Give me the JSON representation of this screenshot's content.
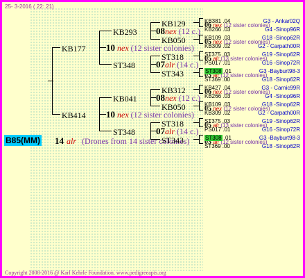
{
  "date": "25-  3-2016 ( 22: 21)",
  "copyright": "Copyright 2008-2016 @ Karl Kehrle Foundation.   www.pedigreeapis.org",
  "root": {
    "id": "B85(MM)",
    "count": "14",
    "race": "alr",
    "note": "(Drones from 14 sister colonies)"
  },
  "level1": [
    {
      "id": "KB177",
      "count": "10",
      "race": "nex",
      "note": "(12 sister colonies)"
    },
    {
      "id": "KB414",
      "count": "10",
      "race": "nex",
      "note": "(12 sister colonies)"
    }
  ],
  "level2": [
    {
      "id": "KB293",
      "count": "08",
      "race": "nex",
      "note": "(12 c.)"
    },
    {
      "id": "ST348",
      "count": "07",
      "race": "alr",
      "note": "(14 c.)"
    },
    {
      "id": "KB041",
      "count": "08",
      "race": "nex",
      "note": "(12 c.)"
    },
    {
      "id": "ST348",
      "count": "07",
      "race": "alr",
      "note": "(14 c.)"
    }
  ],
  "level3": [
    {
      "id": "KB129",
      "count": "06",
      "race": "nex",
      "note": "(12 sister colonies)"
    },
    {
      "id": "KB050",
      "count": "05",
      "race": "nex",
      "note": "(12 sister colonies)"
    },
    {
      "id": "ST318",
      "count": "05",
      "race": "alr",
      "note": "(13 sister colonies)"
    },
    {
      "id": "ST343",
      "count": "03",
      "race": "alr",
      "note": "(12 sister colonies)"
    },
    {
      "id": "KB312",
      "count": "06",
      "race": "nex",
      "note": "(12 sister colonies)"
    },
    {
      "id": "KB050",
      "count": "05",
      "race": "nex",
      "note": "(12 sister colonies)"
    },
    {
      "id": "ST318",
      "count": "05",
      "race": "alr",
      "note": "(13 sister colonies)"
    },
    {
      "id": "ST343",
      "count": "03",
      "race": "alr",
      "note": "(12 sister colonies)"
    }
  ],
  "level4": [
    {
      "id": "KB381",
      "num": ".04",
      "loc": "G3 - Ankar02Q"
    },
    {
      "id": "KB266",
      "num": ".03",
      "loc": "G4 -Sinop96R"
    },
    {
      "id": "KB109",
      "num": ".03",
      "loc": "G18 -Sinop62R"
    },
    {
      "id": "KB309",
      "num": ".02",
      "loc": "G2 - Carpath00R"
    },
    {
      "id": "ST375",
      "num": ".03",
      "loc": "G19 -Sinop62R"
    },
    {
      "id": "PS017",
      "num": ".01",
      "loc": "G16 -Sinop72R"
    },
    {
      "id": "ST308",
      "num": ".01",
      "loc": "G3 -Bayburt98-3",
      "hl": true
    },
    {
      "id": "ST369",
      "num": ".00",
      "loc": "G18 -Sinop62R"
    },
    {
      "id": "KB427",
      "num": ".04",
      "loc": "G3 - Carnic99R"
    },
    {
      "id": "KB266",
      "num": ".03",
      "loc": "G4 -Sinop96R"
    },
    {
      "id": "KB109",
      "num": ".03",
      "loc": "G18 -Sinop62R"
    },
    {
      "id": "KB309",
      "num": ".02",
      "loc": "G2 - Carpath00R"
    },
    {
      "id": "ST375",
      "num": ".03",
      "loc": "G19 -Sinop62R"
    },
    {
      "id": "PS017",
      "num": ".01",
      "loc": "G16 -Sinop72R"
    },
    {
      "id": "ST308",
      "num": ".01",
      "loc": "G3 -Bayburt98-3",
      "hl": true
    },
    {
      "id": "ST369",
      "num": ".00",
      "loc": "G18 -Sinop62R"
    }
  ]
}
